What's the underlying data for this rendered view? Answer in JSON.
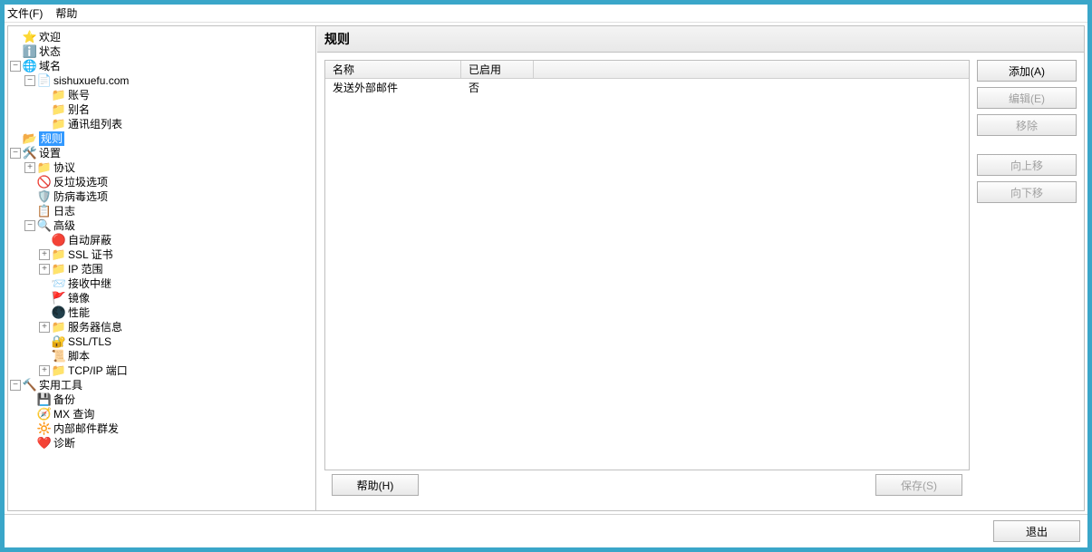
{
  "menu": {
    "file": "文件(F)",
    "help": "帮助"
  },
  "tree": {
    "welcome": "欢迎",
    "status": "状态",
    "domains": "域名",
    "domain_name": "sishuxuefu.com",
    "accounts": "账号",
    "aliases": "别名",
    "distlists": "通讯组列表",
    "rules": "规则",
    "settings": "设置",
    "protocols": "协议",
    "antispam": "反垃圾选项",
    "antivirus": "防病毒选项",
    "logging": "日志",
    "advanced": "高级",
    "autoban": "自动屏蔽",
    "sslcerts": "SSL 证书",
    "ipranges": "IP 范围",
    "incoming": "接收中继",
    "mirror": "镜像",
    "performance": "性能",
    "serverinfo": "服务器信息",
    "ssltls": "SSL/TLS",
    "scripts": "脚本",
    "tcpip": "TCP/IP 端口",
    "utilities": "实用工具",
    "backup": "备份",
    "mxquery": "MX 查询",
    "massmail": "内部邮件群发",
    "diagnostics": "诊断"
  },
  "panel": {
    "title": "规则",
    "columns": {
      "name": "名称",
      "enabled": "已启用"
    },
    "rows": [
      {
        "name": "发送外部邮件",
        "enabled": "否"
      }
    ]
  },
  "buttons": {
    "add": "添加(A)",
    "edit": "编辑(E)",
    "remove": "移除",
    "moveup": "向上移",
    "movedown": "向下移",
    "help": "帮助(H)",
    "save": "保存(S)",
    "exit": "退出"
  }
}
